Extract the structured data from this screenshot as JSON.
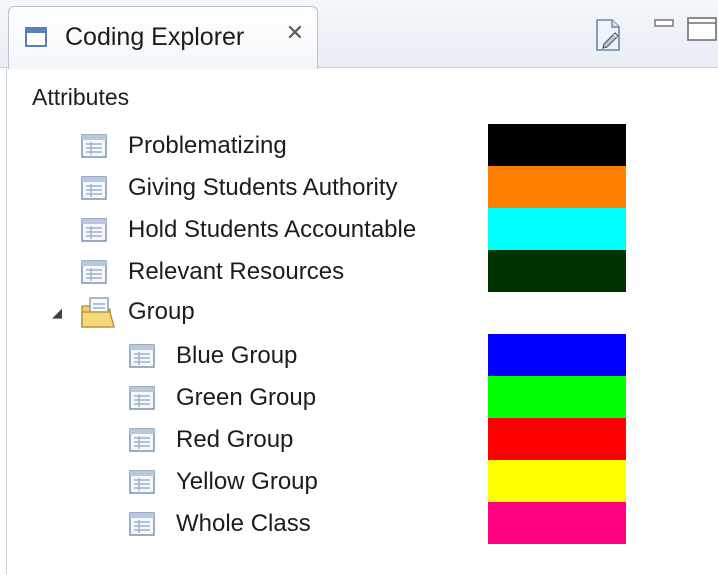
{
  "tab": {
    "title": "Coding Explorer",
    "close_glyph": "✕"
  },
  "section_label": "Attributes",
  "attributes": [
    {
      "label": "Problematizing",
      "color": "#000000"
    },
    {
      "label": "Giving Students Authority",
      "color": "#ff7f00"
    },
    {
      "label": "Hold Students Accountable",
      "color": "#00ffff"
    },
    {
      "label": "Relevant Resources",
      "color": "#003300"
    }
  ],
  "group": {
    "label": "Group",
    "expanded": true,
    "items": [
      {
        "label": "Blue Group",
        "color": "#0000ff"
      },
      {
        "label": "Green Group",
        "color": "#00ff00"
      },
      {
        "label": "Red Group",
        "color": "#ff0000"
      },
      {
        "label": "Yellow Group",
        "color": "#ffff00"
      },
      {
        "label": "Whole Class",
        "color": "#ff0080"
      }
    ]
  },
  "icons": {
    "tab": "view-icon",
    "toolbar": "edit-document-icon",
    "minimize": "minimize-icon",
    "maximize": "maximize-icon",
    "attribute": "table-icon",
    "group": "folder-icon",
    "expander": "expanded-triangle-icon"
  }
}
